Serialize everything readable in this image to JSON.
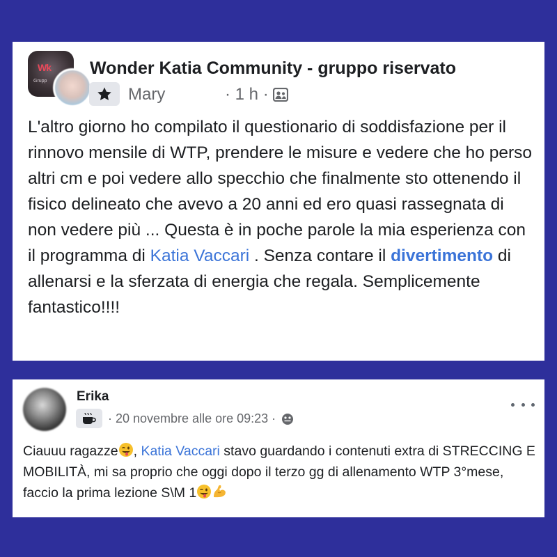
{
  "colors": {
    "background": "#2e2f9b",
    "card": "#ffffff",
    "text": "#1c1e21",
    "meta_text": "#65676b",
    "mention": "#3b74d8"
  },
  "post1": {
    "group_avatar_text": "Wk",
    "group_avatar_subtext": "Grupp",
    "group_name": "Wonder Katia Community - gruppo riservato",
    "badge_icon": "star-badge-icon",
    "author": "Mary",
    "time": "· 1 h ·",
    "privacy_icon": "group-members-icon",
    "body": {
      "part1": "L'altro giorno ho compilato il questionario di soddisfazione per il rinnovo mensile di WTP, prendere le misure e vedere che ho perso altri cm e poi vedere allo specchio che finalmente sto ottenendo il fisico delineato che avevo a 20 anni ed ero quasi rassegnata di non vedere più ... Questa è in poche parole la mia esperienza con il programma di ",
      "mention": "Katia Vaccari",
      "part2": " . Senza contare il ",
      "hashtag": "divertimento",
      "part3": " di allenarsi e la sferzata di energia che regala. Semplicemente fantastico!!!!"
    }
  },
  "post2": {
    "author": "Erika",
    "badge_icon": "coffee-cup-icon",
    "time": "· 20 novembre alle ore 09:23 ·",
    "privacy_icon": "globe-icon",
    "more_icon": "more-options-icon",
    "body": {
      "part1": "Ciauuu ragazze",
      "mention": "Katia Vaccari",
      "part2": " stavo guardando i contenuti extra di STRECCING E MOBILITÀ, mi sa proprio che oggi dopo il terzo gg di allenamento WTP 3°mese, faccio la prima lezione S\\M 1",
      "emoji1": "winking-face-tongue-icon",
      "emoji2": "flexed-biceps-icon"
    }
  }
}
